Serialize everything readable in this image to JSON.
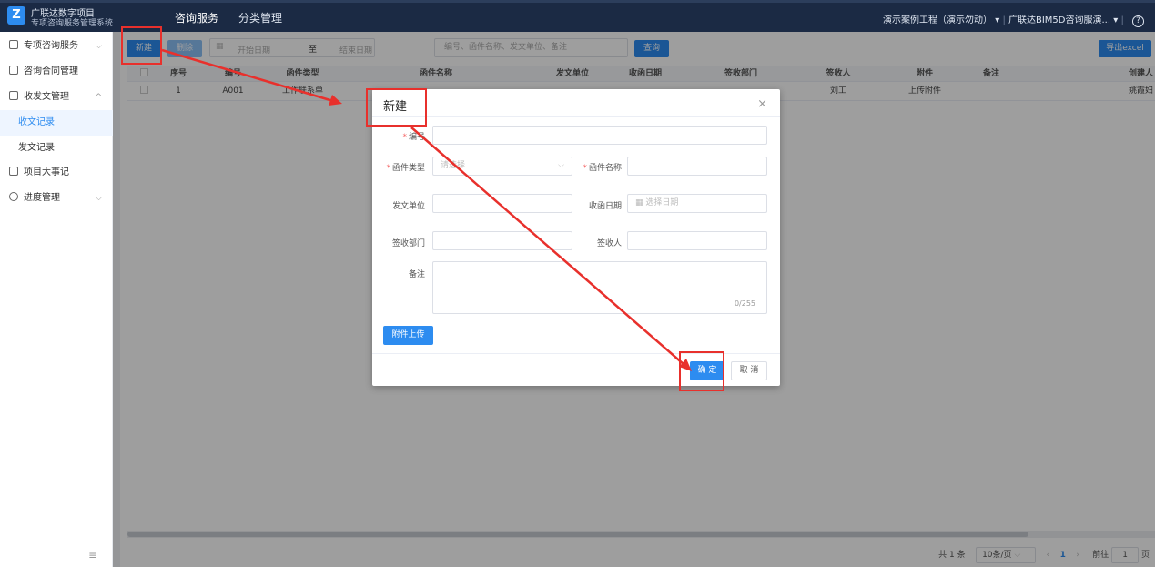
{
  "header": {
    "brand_line1": "广联达数字项目",
    "brand_line2": "专项咨询服务管理系统",
    "logo_letter": "Z",
    "nav": [
      {
        "label": "咨询服务",
        "active": true
      },
      {
        "label": "分类管理",
        "active": false
      }
    ],
    "project": "演示案例工程（演示勿动）",
    "org": "广联达BIM5D咨询服演...",
    "help": "?"
  },
  "sidebar": {
    "items": [
      {
        "label": "专项咨询服务"
      },
      {
        "label": "咨询合同管理"
      },
      {
        "label": "收发文管理"
      },
      {
        "label": "收文记录"
      },
      {
        "label": "发文记录"
      },
      {
        "label": "项目大事记"
      },
      {
        "label": "进度管理"
      }
    ],
    "collapse": "≡"
  },
  "toolbar": {
    "new_label": "新建",
    "delete_label": "删除",
    "date_start_placeholder": "开始日期",
    "date_sep": "至",
    "date_end_placeholder": "结束日期",
    "search_placeholder": "编号、函件名称、发文单位、备注",
    "query_label": "查询",
    "export_label": "导出excel"
  },
  "table": {
    "columns": [
      "序号",
      "编号",
      "函件类型",
      "函件名称",
      "发文单位",
      "收函日期",
      "签收部门",
      "签收人",
      "附件",
      "备注",
      "创建人"
    ],
    "rows": [
      {
        "index": "1",
        "code": "A001",
        "type": "工作联系单",
        "name": "",
        "sender": "",
        "date": "",
        "dept": "",
        "signer": "刘工",
        "attachment": "上传附件",
        "remark": "",
        "creator": "姚霞妇"
      }
    ]
  },
  "pagination": {
    "total": "共 1 条",
    "page_size": "10条/页",
    "current": "1",
    "goto_label": "前往",
    "goto_value": "1",
    "page_suffix": "页"
  },
  "dialog": {
    "title": "新建",
    "close": "×",
    "fields": {
      "code_label": "编号",
      "type_label": "函件类型",
      "type_placeholder": "请选择",
      "name_label": "函件名称",
      "sender_label": "发文单位",
      "date_label": "收函日期",
      "date_placeholder": "选择日期",
      "dept_label": "签收部门",
      "signer_label": "签收人",
      "remark_label": "备注",
      "remark_counter": "0/255"
    },
    "upload_label": "附件上传",
    "confirm_label": "确 定",
    "cancel_label": "取 消"
  },
  "colors": {
    "primary": "#2d8cf0",
    "header_bg": "#1b2a44",
    "annotation": "#e8302c"
  }
}
